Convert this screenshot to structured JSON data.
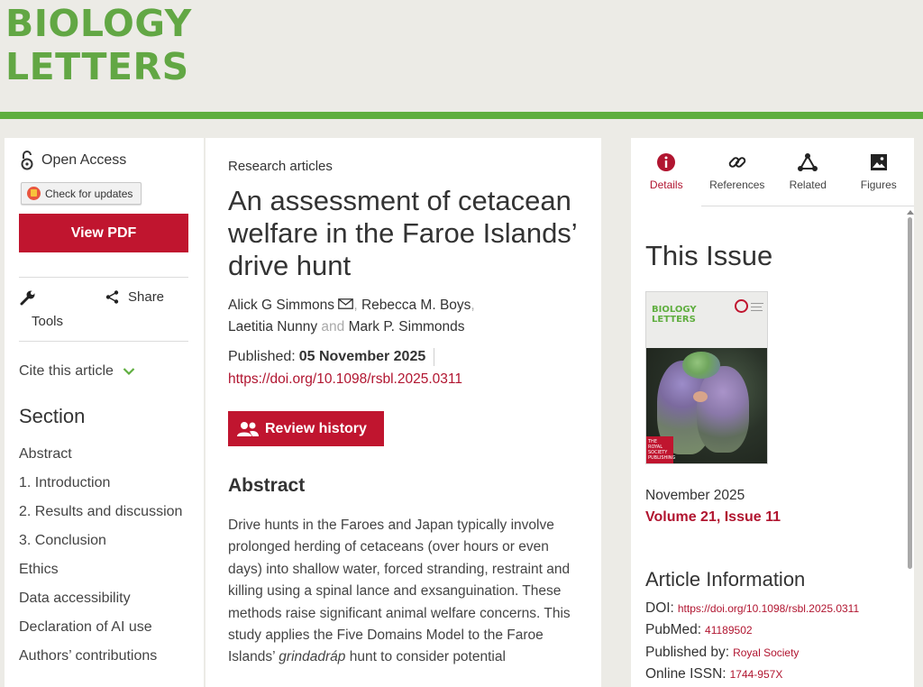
{
  "header": {
    "logo_line1": "BIOLOGY",
    "logo_line2": "LETTERS",
    "brand_color": "#5fae3f"
  },
  "sidebar": {
    "open_access": "Open Access",
    "check_updates": "Check for updates",
    "view_pdf": "View PDF",
    "tools": "Tools",
    "share": "Share",
    "cite": "Cite this article",
    "section_heading": "Section",
    "sections": [
      "Abstract",
      "1. Introduction",
      "2. Results and discussion",
      "3. Conclusion",
      "Ethics",
      "Data accessibility",
      "Declaration of AI use",
      "Authors’ contributions"
    ]
  },
  "article": {
    "kicker": "Research articles",
    "title": "An assessment of cetacean welfare in the Faroe Islands’ drive hunt",
    "authors": {
      "a1": "Alick G Simmons",
      "a2": "Rebecca M. Boys",
      "a3": "Laetitia Nunny",
      "and": "and",
      "a4": "Mark P. Simmonds"
    },
    "published_label": "Published:",
    "published_date": "05 November 2025",
    "doi": "https://doi.org/10.1098/rsbl.2025.0311",
    "review_history": "Review history",
    "abstract_heading": "Abstract",
    "abstract_pre": "Drive hunts in the Faroes and Japan typically involve prolonged herding of cetaceans (over hours or even days) into shallow water, forced stranding, restraint and killing using a spinal lance and exsanguination. These methods raise significant animal welfare concerns. This study applies the Five Domains Model to the Faroe Islands’ ",
    "abstract_em": "grindadráp",
    "abstract_post": " hunt to consider potential"
  },
  "panel": {
    "tabs": [
      {
        "label": "Details",
        "icon": "info-icon",
        "active": true
      },
      {
        "label": "References",
        "icon": "link-icon",
        "active": false
      },
      {
        "label": "Related",
        "icon": "network-icon",
        "active": false
      },
      {
        "label": "Figures",
        "icon": "image-icon",
        "active": false
      }
    ],
    "this_issue": "This Issue",
    "cover_title_line1": "BIOLOGY",
    "cover_title_line2": "LETTERS",
    "cover_publisher": "THE ROYAL SOCIETY PUBLISHING",
    "issue_date": "November 2025",
    "issue_volume": "Volume 21, Issue 11",
    "article_info_heading": "Article Information",
    "info": {
      "doi_label": "DOI:",
      "doi_value": "https://doi.org/10.1098/rsbl.2025.0311",
      "pubmed_label": "PubMed:",
      "pubmed_value": "41189502",
      "publisher_label": "Published by:",
      "publisher_value": "Royal Society",
      "issn_label": "Online ISSN:",
      "issn_value": "1744-957X"
    }
  }
}
